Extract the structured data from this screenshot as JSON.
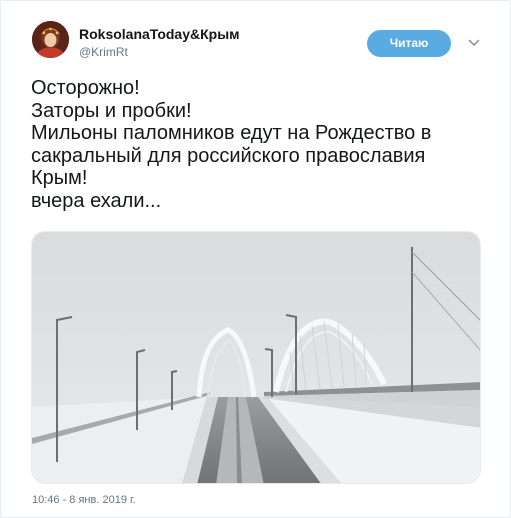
{
  "author": {
    "display_name": "RoksolanaToday&Крым",
    "handle": "@KrimRt",
    "avatar_icon": "avatar-portrait"
  },
  "follow_button": {
    "label": "Читаю",
    "color": "#5aabe2"
  },
  "menu_icon": "chevron-down-icon",
  "tweet": {
    "lines": [
      "Осторожно!",
      "Заторы и пробки!",
      "Мильоны паломников едут на Рождество в",
      "сакральный для российского православия",
      "Крым!",
      "вчера ехали..."
    ]
  },
  "media": {
    "subject": "snow-covered-bridge-road-photo"
  },
  "timestamp": "10:46 - 8 янв. 2019 г."
}
